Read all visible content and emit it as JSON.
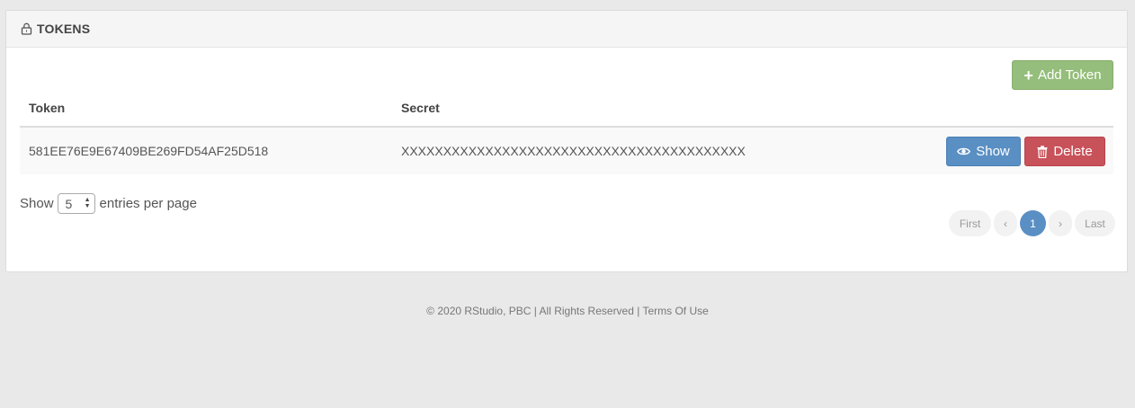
{
  "panel": {
    "title": "TOKENS"
  },
  "actions": {
    "add_label": "Add Token"
  },
  "table": {
    "headers": [
      "Token",
      "Secret"
    ],
    "rows": [
      {
        "token": "581EE76E9E67409BE269FD54AF25D518",
        "secret": "XXXXXXXXXXXXXXXXXXXXXXXXXXXXXXXXXXXXXXXXX",
        "show_label": "Show",
        "delete_label": "Delete"
      }
    ]
  },
  "page_size": {
    "prefix": "Show",
    "value": "5",
    "suffix": "entries per page"
  },
  "pagination": {
    "first": "First",
    "prev": "‹",
    "current": "1",
    "next": "›",
    "last": "Last"
  },
  "footer": {
    "text": "© 2020 RStudio, PBC | All Rights Reserved | Terms Of Use"
  },
  "colors": {
    "primary": "#5a8fc4",
    "success": "#95bd7b",
    "danger": "#c8525a"
  },
  "icons": {
    "header": "lock-icon",
    "add": "plus-icon",
    "show": "eye-icon",
    "delete": "trash-icon"
  }
}
